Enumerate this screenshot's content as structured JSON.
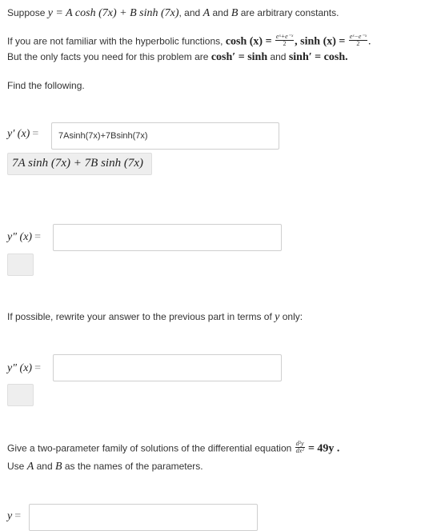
{
  "intro": {
    "line1_prefix": "Suppose",
    "line1_math": "y = A cosh (7x) + B sinh (7x)",
    "line1_mid": ", and",
    "line1_A": "A",
    "line1_and": "and",
    "line1_B": "B",
    "line1_suffix": "are arbitrary constants.",
    "line2_prefix": "If you are not familiar with the hyperbolic functions,",
    "cosh_def": "cosh (x) =",
    "cosh_num": "eˣ+e⁻ˣ",
    "cosh_den": "2",
    "sinh_def": ", sinh (x) =",
    "sinh_num": "eˣ−e⁻ˣ",
    "sinh_den": "2",
    "line3_prefix": "But the only facts you need for this problem are",
    "fact1": "cosh′ = sinh",
    "line3_and": "and",
    "fact2": "sinh′ = cosh."
  },
  "find_text": "Find the following.",
  "q1": {
    "label": "y′ (x)",
    "input_value": "7Asinh(7x)+7Bsinh(7x)",
    "preview": "7A sinh (7x) + 7B sinh (7x)"
  },
  "q2": {
    "label": "y″ (x)",
    "input_value": "",
    "preview": ""
  },
  "rewrite_text_prefix": "If possible, rewrite your answer to the previous part in terms of",
  "rewrite_var": "y",
  "rewrite_text_suffix": "only:",
  "q3": {
    "label": "y″ (x)",
    "input_value": "",
    "preview": ""
  },
  "family": {
    "text_prefix": "Give a two-parameter family of solutions of the differential equation",
    "deq_num": "d²y",
    "deq_den": "dx²",
    "deq_rhs": "= 49y .",
    "line2_prefix": "Use",
    "param_A": "A",
    "line2_and": "and",
    "param_B": "B",
    "line2_suffix": "as the names of the parameters."
  },
  "q4": {
    "label": "y",
    "input_value": ""
  },
  "equals_sign": "="
}
